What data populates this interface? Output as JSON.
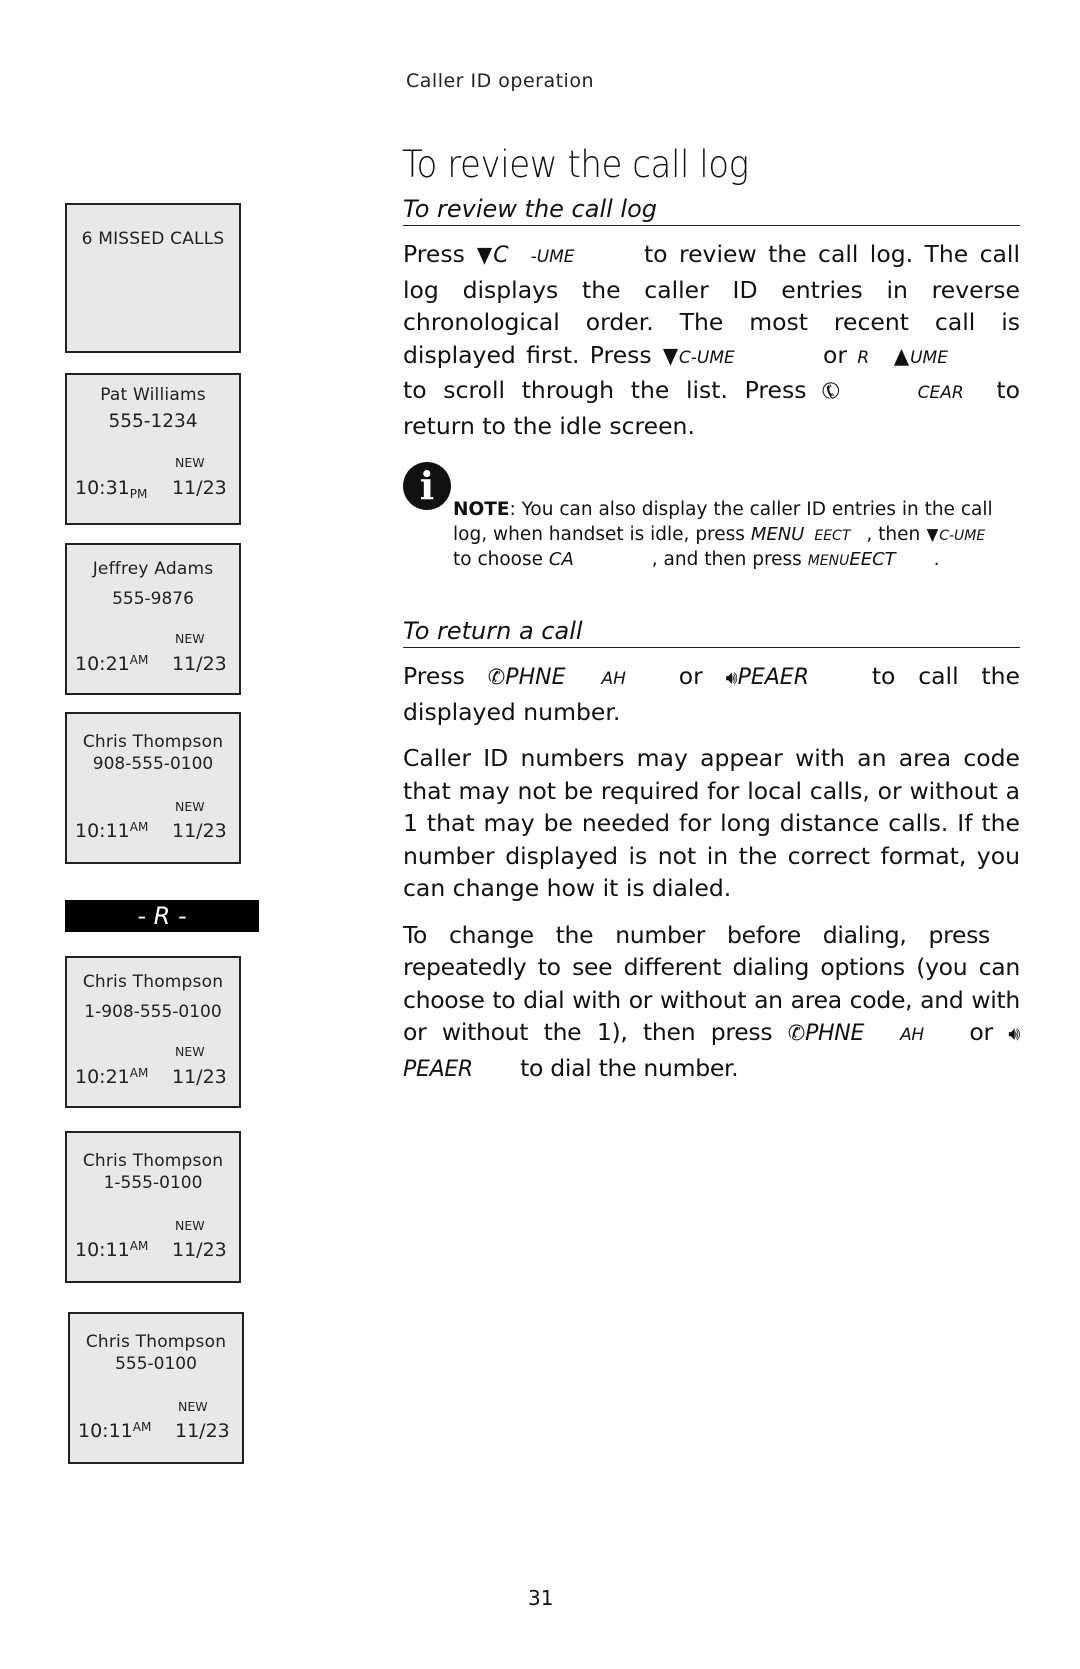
{
  "header": {
    "section": "Caller ID operation"
  },
  "title": "To review the call log",
  "review": {
    "heading": "To review the call log",
    "p1": {
      "t1": "Press",
      "k1a": "C",
      "k1b": "-UME",
      "t2": "to review the call log. The call log displays the caller ID entries in reverse chronological order. The most recent call is displayed first. Press",
      "k2": "C-UME",
      "t3": "or",
      "k3a": "R",
      "k3b": "UME",
      "t4": "to scroll through the list. Press",
      "k4": "CEAR",
      "t5": "to return to the idle screen."
    }
  },
  "note": {
    "icon": "info-icon",
    "label": "NOTE",
    "t1": ": You can also display the caller ID entries in the call log, when handset is idle, press",
    "k1": "MENU",
    "k1b": "EECT",
    "t2": ", then",
    "k2": "C-UME",
    "t3": "to choose",
    "k3": "CA",
    "t4": ", and then press",
    "k4a": "MENU",
    "k4b": "EECT",
    "t5": "."
  },
  "return_call": {
    "heading": "To return a call",
    "p1": {
      "t1": "Press",
      "k1a": "PHNE",
      "k1b": "AH",
      "t2": "or",
      "k2": "PEAER",
      "t3": "to call the displayed number."
    },
    "p2": "Caller ID numbers may appear with an area code that may not be required for local calls, or without a 1 that may be needed for long distance calls. If the number displayed is not in the correct format, you can change how it is dialed.",
    "p3": {
      "t1": "To change the number before dialing, press",
      "t2": "repeatedly to see different dialing options (you can choose to dial with or without an area code, and with or without the 1), then press",
      "k1a": "PHNE",
      "k1b": "AH",
      "t3": "or",
      "k2": "PEAER",
      "t4": "to dial the number."
    }
  },
  "screens": [
    {
      "line1": "6 MISSED CALLS"
    },
    {
      "name": "Pat Williams",
      "number": "555-1234",
      "badge": "NEW",
      "time": "10:31",
      "ampm": "PM",
      "date": "11/23"
    },
    {
      "name": "Jeffrey Adams",
      "number": "555-9876",
      "badge": "NEW",
      "time": "10:21",
      "ampm": "AM",
      "date": "11/23"
    },
    {
      "name": "Chris Thompson",
      "number": "908-555-0100",
      "badge": "NEW",
      "time": "10:11",
      "ampm": "AM",
      "date": "11/23"
    },
    {
      "name": "Chris Thompson",
      "number": "1-908-555-0100",
      "badge": "NEW",
      "time": "10:21",
      "ampm": "AM",
      "date": "11/23"
    },
    {
      "name": "Chris Thompson",
      "number": "1-555-0100",
      "badge": "NEW",
      "time": "10:11",
      "ampm": "AM",
      "date": "11/23"
    },
    {
      "name": "Chris Thompson",
      "number": "555-0100",
      "badge": "NEW",
      "time": "10:11",
      "ampm": "AM",
      "date": "11/23"
    }
  ],
  "banner": "- R -",
  "page_number": "31"
}
